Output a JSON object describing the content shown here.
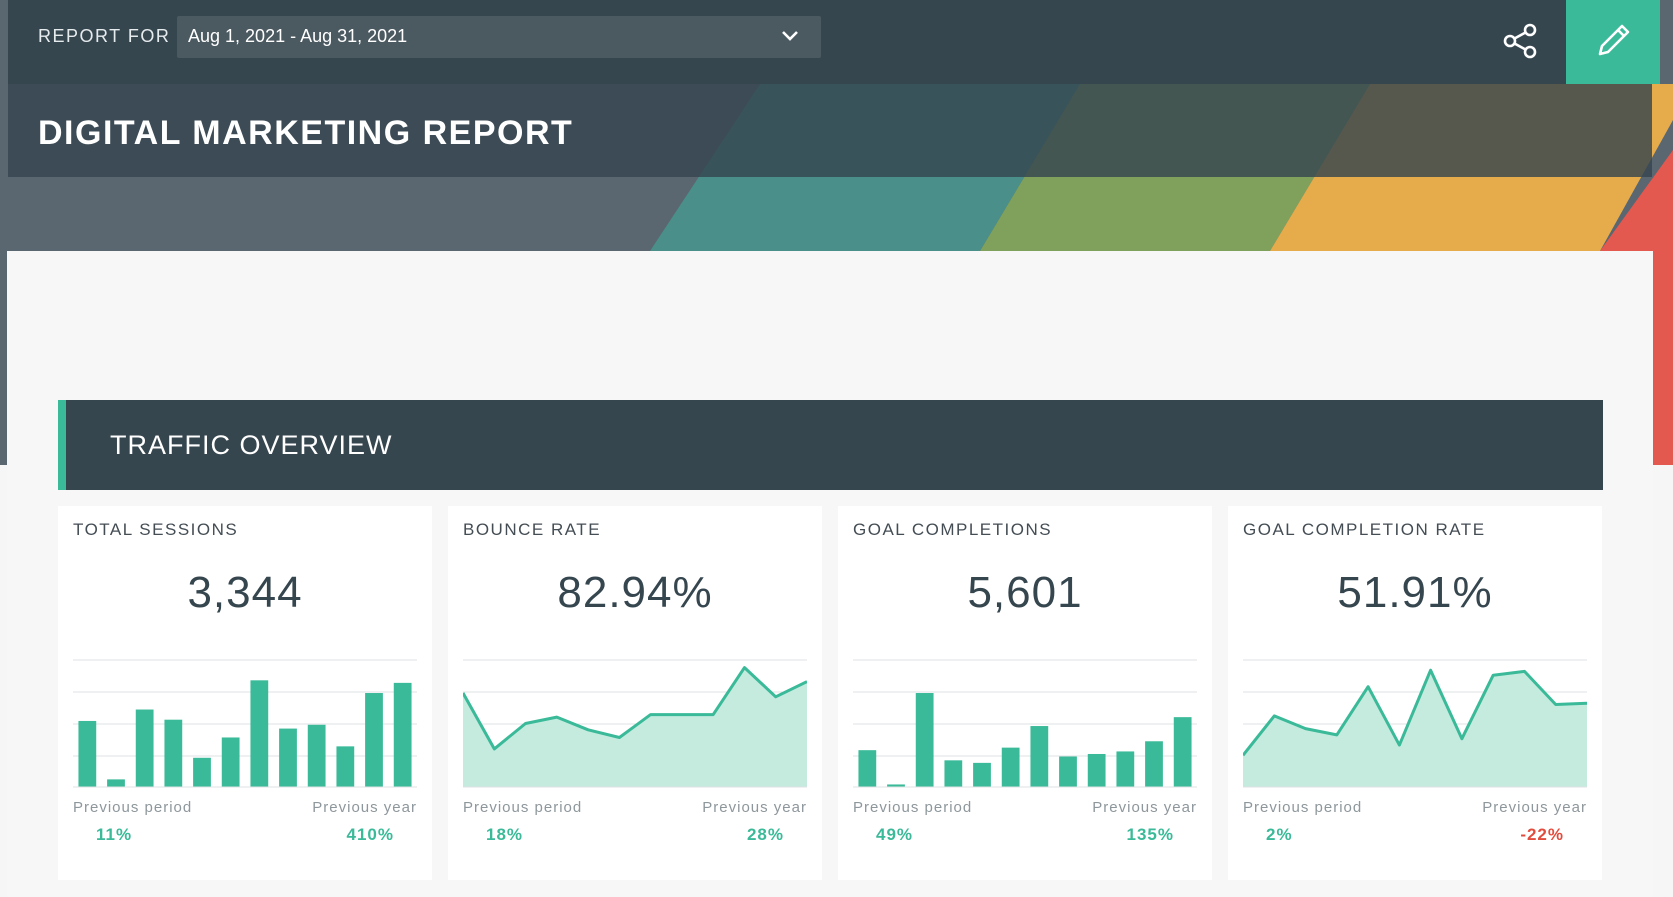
{
  "header": {
    "report_for_label": "REPORT FOR",
    "date_range": "Aug 1, 2021 - Aug 31, 2021",
    "title": "DIGITAL MARKETING REPORT"
  },
  "section": {
    "title": "TRAFFIC OVERVIEW"
  },
  "colors": {
    "accent": "#3aba98",
    "dark": "#36464f",
    "negative": "#e24c3d"
  },
  "cards": [
    {
      "label": "TOTAL SESSIONS",
      "value": "3,344",
      "prev_label": "Previous period",
      "prev_value": "11%",
      "year_label": "Previous year",
      "year_value": "410%",
      "chart_type": "bar",
      "series": [
        0.52,
        0.06,
        0.61,
        0.53,
        0.23,
        0.39,
        0.84,
        0.46,
        0.49,
        0.32,
        0.74,
        0.82
      ]
    },
    {
      "label": "BOUNCE RATE",
      "value": "82.94%",
      "prev_label": "Previous period",
      "prev_value": "18%",
      "year_label": "Previous year",
      "year_value": "28%",
      "chart_type": "area",
      "series": [
        0.74,
        0.3,
        0.5,
        0.55,
        0.45,
        0.39,
        0.57,
        0.57,
        0.57,
        0.94,
        0.71,
        0.83
      ]
    },
    {
      "label": "GOAL COMPLETIONS",
      "value": "5,601",
      "prev_label": "Previous period",
      "prev_value": "49%",
      "year_label": "Previous year",
      "year_value": "135%",
      "chart_type": "bar",
      "series": [
        0.29,
        0.02,
        0.74,
        0.21,
        0.19,
        0.31,
        0.48,
        0.24,
        0.26,
        0.28,
        0.36,
        0.55
      ]
    },
    {
      "label": "GOAL COMPLETION RATE",
      "value": "51.91%",
      "prev_label": "Previous period",
      "prev_value": "2%",
      "year_label": "Previous year",
      "year_value": "-22%",
      "year_negative": true,
      "chart_type": "area",
      "series": [
        0.25,
        0.56,
        0.46,
        0.41,
        0.79,
        0.33,
        0.92,
        0.38,
        0.88,
        0.91,
        0.65,
        0.66
      ]
    }
  ]
}
